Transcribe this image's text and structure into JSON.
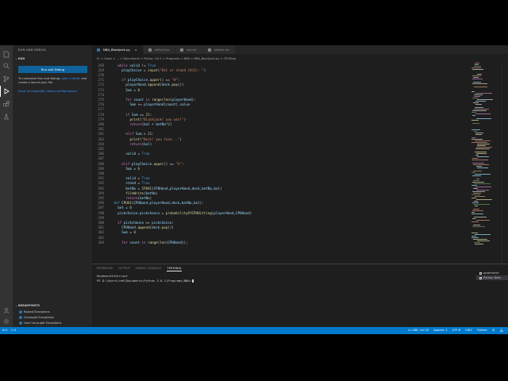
{
  "activity_icons": [
    "files-icon",
    "search-icon",
    "source-control-icon",
    "run-debug-icon",
    "extensions-icon",
    "test-icon",
    "account-icon",
    "settings-gear-icon"
  ],
  "sidebar": {
    "title": "RUN AND DEBUG",
    "section": "RUN",
    "run_button": "Run and Debug",
    "help_pre": "To customize Run and Debug,",
    "help_link": "open a folder",
    "help_post": "and create a launch.json file.",
    "show_all": "Show all automatic debug configurations.",
    "breakpoints_header": "BREAKPOINTS",
    "breakpoints": [
      "Raised Exceptions",
      "Uncaught Exceptions",
      "User Uncaught Exceptions"
    ]
  },
  "tabs": [
    {
      "label": "NBA_Blackjack.py",
      "active": true,
      "icon_color": "#3572a5"
    },
    {
      "label": "pWord.txt",
      "active": false,
      "icon_color": "#858585"
    },
    {
      "label": "bal.txt",
      "active": false,
      "icon_color": "#858585"
    },
    {
      "label": "allbets.txt",
      "active": false,
      "icon_color": "#858585"
    }
  ],
  "breadcrumb": "D: > Users > ... > Documents > Python 3.8.1 > Programs > NBA > NBA_Blackjack.py > CPUStep",
  "code": [
    {
      "n": "268",
      "indent": 2,
      "tokens": [
        [
          "kw",
          "while "
        ],
        [
          "vr",
          "valid"
        ],
        [
          "df",
          " != "
        ],
        [
          "kb",
          "True"
        ]
      ]
    },
    {
      "n": "269",
      "indent": 3,
      "tokens": [
        [
          "vr",
          "playChoice"
        ],
        [
          "df",
          " = "
        ],
        [
          "fn",
          "input"
        ],
        [
          "df",
          "("
        ],
        [
          "st",
          "\"Hit or stand (H/S): \""
        ],
        [
          "df",
          ")"
        ]
      ]
    },
    {
      "n": "270",
      "indent": 0,
      "tokens": []
    },
    {
      "n": "271",
      "indent": 3,
      "tokens": [
        [
          "kw",
          "if "
        ],
        [
          "vr",
          "playChoice"
        ],
        [
          "df",
          "."
        ],
        [
          "fn",
          "upper"
        ],
        [
          "df",
          "() == "
        ],
        [
          "st",
          "\"H\""
        ],
        [
          "df",
          ":"
        ]
      ]
    },
    {
      "n": "272",
      "indent": 4,
      "tokens": [
        [
          "vr",
          "playerHand"
        ],
        [
          "df",
          "."
        ],
        [
          "fn",
          "append"
        ],
        [
          "df",
          "("
        ],
        [
          "vr",
          "deck"
        ],
        [
          "df",
          "."
        ],
        [
          "fn",
          "pop"
        ],
        [
          "df",
          "())"
        ]
      ]
    },
    {
      "n": "273",
      "indent": 4,
      "tokens": [
        [
          "vr",
          "Sum"
        ],
        [
          "df",
          " = "
        ],
        [
          "nm",
          "0"
        ]
      ]
    },
    {
      "n": "274",
      "indent": 0,
      "tokens": []
    },
    {
      "n": "275",
      "indent": 4,
      "tokens": [
        [
          "kw",
          "for "
        ],
        [
          "vr",
          "count"
        ],
        [
          "kw",
          " in "
        ],
        [
          "fn",
          "range"
        ],
        [
          "df",
          "("
        ],
        [
          "fn",
          "len"
        ],
        [
          "df",
          "("
        ],
        [
          "vr",
          "playerHand"
        ],
        [
          "df",
          "):"
        ]
      ]
    },
    {
      "n": "276",
      "indent": 5,
      "tokens": [
        [
          "vr",
          "Sum"
        ],
        [
          "df",
          " += "
        ],
        [
          "vr",
          "playerHand"
        ],
        [
          "df",
          "["
        ],
        [
          "vr",
          "count"
        ],
        [
          "df",
          "]."
        ],
        [
          "vr",
          "value"
        ]
      ]
    },
    {
      "n": "277",
      "indent": 0,
      "tokens": []
    },
    {
      "n": "278",
      "indent": 4,
      "tokens": [
        [
          "kw",
          "if "
        ],
        [
          "vr",
          "Sum"
        ],
        [
          "df",
          " == "
        ],
        [
          "nm",
          "21"
        ],
        [
          "df",
          ":"
        ]
      ]
    },
    {
      "n": "279",
      "indent": 5,
      "tokens": [
        [
          "fn",
          "print"
        ],
        [
          "df",
          "("
        ],
        [
          "st",
          "\"Blackjack! you win!\""
        ],
        [
          "df",
          ")"
        ]
      ]
    },
    {
      "n": "280",
      "indent": 5,
      "tokens": [
        [
          "kw",
          "return"
        ],
        [
          "df",
          "("
        ],
        [
          "vr",
          "bal"
        ],
        [
          "df",
          " + "
        ],
        [
          "vr",
          "betNo"
        ],
        [
          "df",
          "*"
        ],
        [
          "nm",
          "2"
        ],
        [
          "df",
          ")"
        ]
      ]
    },
    {
      "n": "281",
      "indent": 0,
      "tokens": []
    },
    {
      "n": "282",
      "indent": 4,
      "tokens": [
        [
          "kw",
          "elif "
        ],
        [
          "vr",
          "Sum"
        ],
        [
          "df",
          " > "
        ],
        [
          "nm",
          "21"
        ],
        [
          "df",
          ":"
        ]
      ]
    },
    {
      "n": "283",
      "indent": 5,
      "tokens": [
        [
          "fn",
          "print"
        ],
        [
          "df",
          "("
        ],
        [
          "st",
          "\"Bust! you lose...\""
        ],
        [
          "df",
          ")"
        ]
      ]
    },
    {
      "n": "284",
      "indent": 5,
      "tokens": [
        [
          "kw",
          "return"
        ],
        [
          "df",
          "("
        ],
        [
          "vr",
          "bal"
        ],
        [
          "df",
          ")"
        ]
      ]
    },
    {
      "n": "285",
      "indent": 0,
      "tokens": []
    },
    {
      "n": "286",
      "indent": 4,
      "tokens": [
        [
          "vr",
          "valid"
        ],
        [
          "df",
          " = "
        ],
        [
          "kb",
          "True"
        ]
      ]
    },
    {
      "n": "287",
      "indent": 0,
      "tokens": []
    },
    {
      "n": "288",
      "indent": 3,
      "tokens": [
        [
          "kw",
          "elif "
        ],
        [
          "vr",
          "playChoice"
        ],
        [
          "df",
          "."
        ],
        [
          "fn",
          "upper"
        ],
        [
          "df",
          "() == "
        ],
        [
          "st",
          "\"S\""
        ],
        [
          "df",
          ":"
        ]
      ]
    },
    {
      "n": "289",
      "indent": 4,
      "tokens": [
        [
          "vr",
          "Sum"
        ],
        [
          "df",
          " = "
        ],
        [
          "nm",
          "0"
        ]
      ]
    },
    {
      "n": "290",
      "indent": 0,
      "tokens": []
    },
    {
      "n": "291",
      "indent": 4,
      "tokens": [
        [
          "vr",
          "valid"
        ],
        [
          "df",
          " = "
        ],
        [
          "kb",
          "True"
        ]
      ]
    },
    {
      "n": "292",
      "indent": 4,
      "tokens": [
        [
          "vr",
          "stand"
        ],
        [
          "df",
          " = "
        ],
        [
          "kb",
          "True"
        ]
      ]
    },
    {
      "n": "293",
      "indent": 4,
      "tokens": [
        [
          "vr",
          "betNo"
        ],
        [
          "df",
          " = "
        ],
        [
          "fn",
          "CPUAI"
        ],
        [
          "df",
          "("
        ],
        [
          "vr",
          "CPUHand"
        ],
        [
          "df",
          ","
        ],
        [
          "vr",
          "playerHand"
        ],
        [
          "df",
          ","
        ],
        [
          "vr",
          "deck"
        ],
        [
          "df",
          ","
        ],
        [
          "vr",
          "betNo"
        ],
        [
          "df",
          ","
        ],
        [
          "vr",
          "bal"
        ],
        [
          "df",
          ")"
        ]
      ]
    },
    {
      "n": "294",
      "indent": 4,
      "tokens": [
        [
          "fn",
          "fileWrite"
        ],
        [
          "df",
          "("
        ],
        [
          "vr",
          "betNo"
        ],
        [
          "df",
          ")"
        ]
      ]
    },
    {
      "n": "295",
      "indent": 4,
      "tokens": [
        [
          "kw",
          "return"
        ],
        [
          "df",
          "("
        ],
        [
          "vr",
          "betNo"
        ],
        [
          "df",
          ")"
        ]
      ]
    },
    {
      "n": "296",
      "indent": 1,
      "tokens": [
        [
          "kb",
          "def "
        ],
        [
          "fn",
          "CPUAI"
        ],
        [
          "df",
          "("
        ],
        [
          "vr",
          "CPUHand"
        ],
        [
          "df",
          ","
        ],
        [
          "vr",
          "playerHand"
        ],
        [
          "df",
          ","
        ],
        [
          "vr",
          "deck"
        ],
        [
          "df",
          ","
        ],
        [
          "vr",
          "betNo"
        ],
        [
          "df",
          ","
        ],
        [
          "vr",
          "bal"
        ],
        [
          "df",
          "):"
        ]
      ]
    },
    {
      "n": "297",
      "indent": 2,
      "tokens": [
        [
          "vr",
          "bet"
        ],
        [
          "df",
          " = "
        ],
        [
          "nm",
          "0"
        ]
      ]
    },
    {
      "n": "298",
      "indent": 2,
      "tokens": [
        [
          "vr",
          "pickchoice"
        ],
        [
          "df",
          "."
        ],
        [
          "vr",
          "pickchance"
        ],
        [
          "df",
          " = "
        ],
        [
          "fn",
          "probabilityOfCPUHitting"
        ],
        [
          "df",
          "("
        ],
        [
          "vr",
          "playerHand"
        ],
        [
          "df",
          ","
        ],
        [
          "vr",
          "CPUHand"
        ],
        [
          "df",
          ")"
        ]
      ]
    },
    {
      "n": "299",
      "indent": 0,
      "tokens": []
    },
    {
      "n": "300",
      "indent": 2,
      "tokens": [
        [
          "kw",
          "if "
        ],
        [
          "vr",
          "pickchance"
        ],
        [
          "df",
          " >= "
        ],
        [
          "vr",
          "pickchoice"
        ],
        [
          "df",
          ":"
        ]
      ]
    },
    {
      "n": "301",
      "indent": 3,
      "tokens": [
        [
          "vr",
          "CPUHand"
        ],
        [
          "df",
          "."
        ],
        [
          "fn",
          "append"
        ],
        [
          "df",
          "("
        ],
        [
          "vr",
          "deck"
        ],
        [
          "df",
          "."
        ],
        [
          "fn",
          "pop"
        ],
        [
          "df",
          "())"
        ]
      ]
    },
    {
      "n": "302",
      "indent": 3,
      "tokens": [
        [
          "vr",
          "Sum"
        ],
        [
          "df",
          " = "
        ],
        [
          "nm",
          "0"
        ]
      ]
    },
    {
      "n": "303",
      "indent": 0,
      "tokens": []
    },
    {
      "n": "304",
      "indent": 3,
      "tokens": [
        [
          "kw",
          "for "
        ],
        [
          "vr",
          "count"
        ],
        [
          "kw",
          " in "
        ],
        [
          "fn",
          "range"
        ],
        [
          "df",
          "("
        ],
        [
          "fn",
          "len"
        ],
        [
          "df",
          "("
        ],
        [
          "vr",
          "CPUHand"
        ],
        [
          "df",
          "));"
        ]
      ]
    }
  ],
  "panel": {
    "tabs": [
      "PROBLEMS",
      "OUTPUT",
      "DEBUG CONSOLE",
      "TERMINAL"
    ],
    "active_tab": "TERMINAL",
    "terminal_lines": [
      "KeyboardInterrupt",
      "PS D:\\Users\\red\\Documents\\Python 3.8.1\\Programs\\NBA>"
    ],
    "terminals": [
      "powershell",
      "Python Deb..."
    ]
  },
  "status": {
    "left": [
      "⊗ 0",
      "⚠ 0"
    ],
    "right": [
      "Ln 286, Col 25",
      "Spaces: 2",
      "UTF-8",
      "CRLF",
      "Python"
    ]
  },
  "colors": {
    "statusbar": "#007acc",
    "button": "#0e639c",
    "editor_bg": "#1e1e1e",
    "sidebar_bg": "#252526",
    "activity_bg": "#333333"
  }
}
